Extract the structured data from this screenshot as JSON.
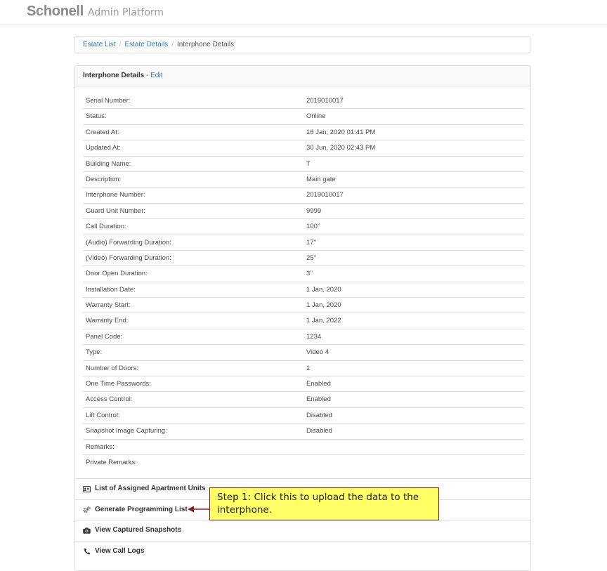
{
  "app": {
    "logo_brand": "Schonell",
    "logo_subtitle": "Admin Platform"
  },
  "breadcrumb": {
    "items": [
      {
        "label": "Estate List",
        "link": true
      },
      {
        "label": "Estate Details",
        "link": true
      },
      {
        "label": "Interphone Details",
        "link": false
      }
    ],
    "separator": "/"
  },
  "panel": {
    "title": "Interphone Details",
    "dash": " - ",
    "edit_label": "Edit"
  },
  "details": [
    {
      "label": "Serial Number:",
      "value": "2019010017"
    },
    {
      "label": "Status:",
      "value": "Online"
    },
    {
      "label": "Created At:",
      "value": "16 Jan, 2020 01:41 PM"
    },
    {
      "label": "Updated At:",
      "value": "30 Jun, 2020 02:43 PM"
    },
    {
      "label": "Building Name:",
      "value": "T"
    },
    {
      "label": "Description:",
      "value": "Main gate"
    },
    {
      "label": "Interphone Number:",
      "value": "2019010017"
    },
    {
      "label": "Guard Unit Number:",
      "value": "9999"
    },
    {
      "label": "Call Duration:",
      "value": "100’’"
    },
    {
      "label": "(Audio) Forwarding Duration:",
      "value": "17’’"
    },
    {
      "label": "(Video) Forwarding Duration:",
      "value": "25’’"
    },
    {
      "label": "Door Open Duration:",
      "value": "3’’"
    },
    {
      "label": "Installation Date:",
      "value": "1 Jan, 2020"
    },
    {
      "label": "Warranty Start:",
      "value": "1 Jan, 2020"
    },
    {
      "label": "Warranty End:",
      "value": "1 Jan, 2022"
    },
    {
      "label": "Panel Code:",
      "value": "1234"
    },
    {
      "label": "Type:",
      "value": "Video 4"
    },
    {
      "label": "Number of Doors:",
      "value": "1"
    },
    {
      "label": "One Time Passwords:",
      "value": "Enabled"
    },
    {
      "label": "Access Control:",
      "value": "Enabled"
    },
    {
      "label": "Lift Control:",
      "value": "Disabled"
    },
    {
      "label": "Snapshot Image Capturing:",
      "value": "Disabled"
    },
    {
      "label": "Remarks:",
      "value": ""
    },
    {
      "label": "Private Remarks:",
      "value": ""
    }
  ],
  "actions": [
    {
      "label": "List of Assigned Apartment Units",
      "icon": "id-card-icon"
    },
    {
      "label": "Generate Programming List",
      "icon": "gears-icon"
    },
    {
      "label": "View Captured Snapshots",
      "icon": "camera-icon"
    },
    {
      "label": "View Call Logs",
      "icon": "phone-icon"
    }
  ],
  "callout": {
    "text": "Step 1: Click this to upload the data to the interphone."
  },
  "colors": {
    "link": "#337ab7",
    "callout_background": "#ffff66",
    "callout_border": "#8b1a1a"
  }
}
